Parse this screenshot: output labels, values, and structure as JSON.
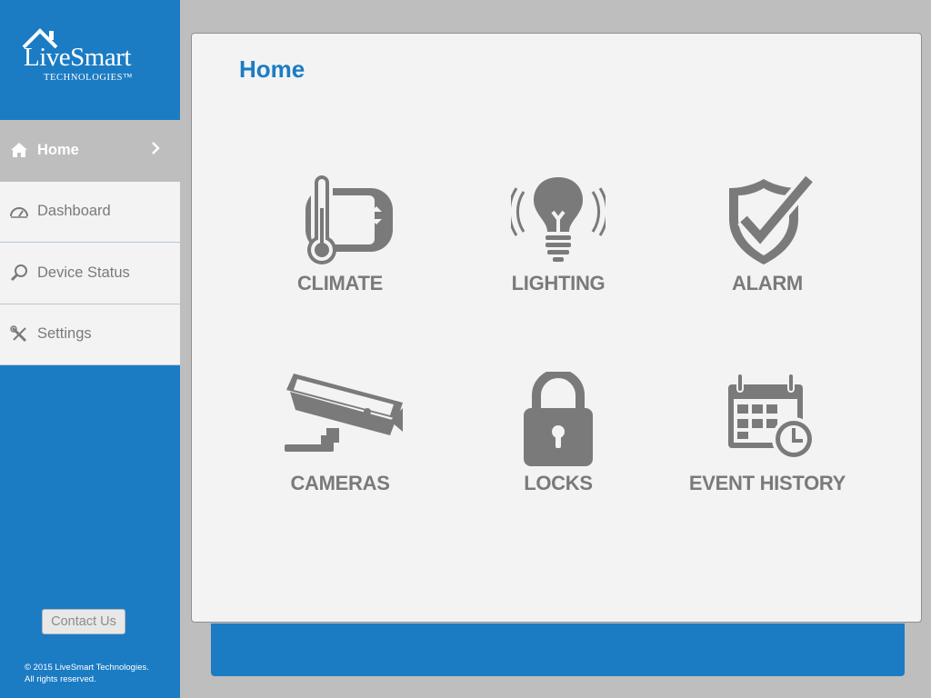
{
  "logo": {
    "brand": "LiveSmart",
    "sub": "TECHNOLOGIES™"
  },
  "nav": {
    "items": [
      {
        "label": "Home",
        "icon": "home-icon",
        "active": true
      },
      {
        "label": "Dashboard",
        "icon": "gauge-icon"
      },
      {
        "label": "Device Status",
        "icon": "magnifier-icon"
      },
      {
        "label": "Settings",
        "icon": "tools-icon"
      }
    ]
  },
  "contact_label": "Contact Us",
  "copyright": {
    "line1": "© 2015 LiveSmart Technologies.",
    "line2": "All rights reserved."
  },
  "main": {
    "title": "Home",
    "tiles": [
      {
        "label": "CLIMATE",
        "icon": "thermostat-icon"
      },
      {
        "label": "LIGHTING",
        "icon": "lightbulb-icon"
      },
      {
        "label": "ALARM",
        "icon": "shield-check-icon"
      },
      {
        "label": "CAMERAS",
        "icon": "security-camera-icon"
      },
      {
        "label": "LOCKS",
        "icon": "padlock-icon"
      },
      {
        "label": "EVENT HISTORY",
        "icon": "calendar-clock-icon"
      }
    ]
  },
  "colors": {
    "brand_blue": "#1b7cc4",
    "icon_gray": "#7a7a7a",
    "panel_bg": "#f3f3f3",
    "page_bg": "#bebebe"
  }
}
